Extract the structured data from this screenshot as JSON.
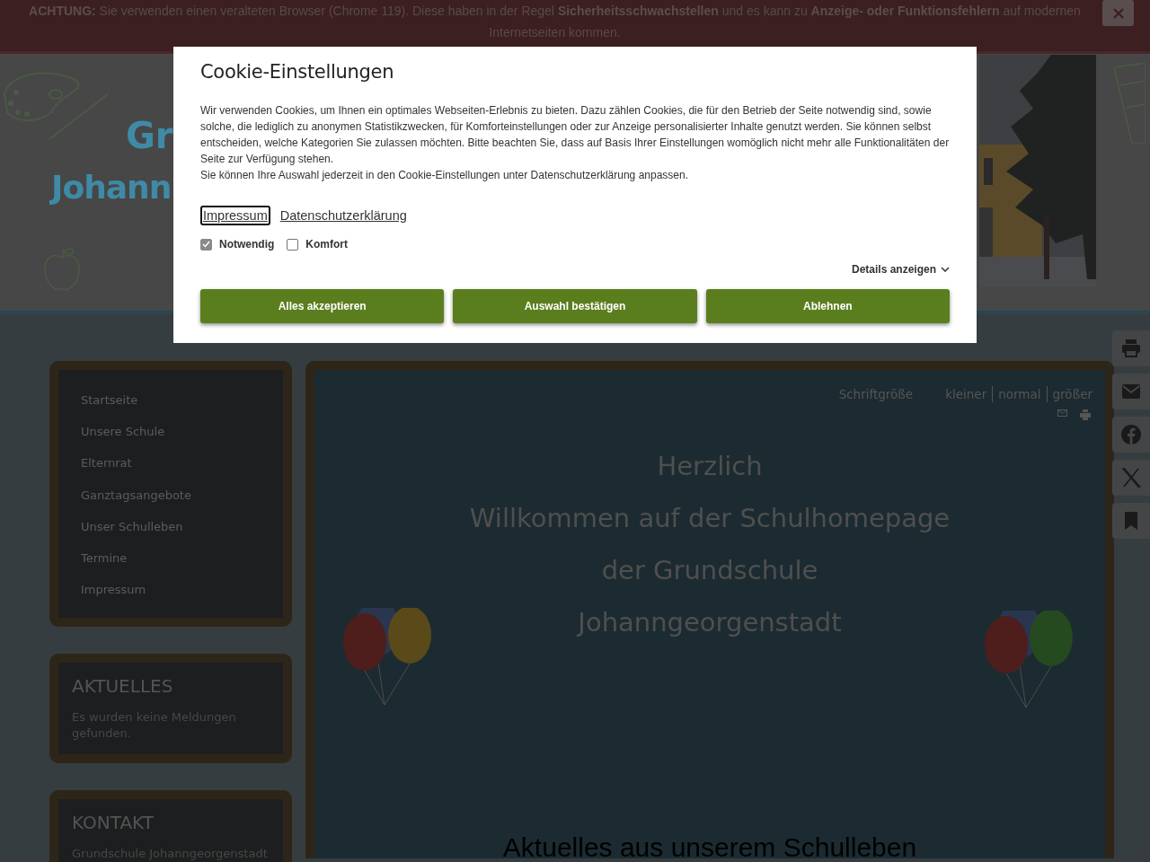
{
  "browser_warning": {
    "text": "**ACHTUNG:** Sie verwenden einen veralteten Browser (Chrome 119). Diese haben in der Regel **Sicherheitsschwachstellen** und es kann zu **Anzeige- oder Funktionsfehlern** auf modernen Internetseiten kommen."
  },
  "header": {
    "logo_lines": [
      "Gr",
      "Johann"
    ]
  },
  "navigation": [
    {
      "label": "Startseite"
    },
    {
      "label": "Unsere Schule"
    },
    {
      "label": "Elternrat"
    },
    {
      "label": "Ganztagsangebote"
    },
    {
      "label": "Unser Schulleben"
    },
    {
      "label": "Termine"
    },
    {
      "label": "Impressum"
    }
  ],
  "aktuelles": {
    "title": "AKTUELLES",
    "text": "Es wurden keine Meldungen gefunden."
  },
  "kontakt": {
    "title": "KONTAKT",
    "text": "Grundschule Johanngeorgenstadt"
  },
  "font_size": {
    "label": "Schriftgröße",
    "options": [
      "kleiner",
      "normal",
      "größer"
    ]
  },
  "welcome_lines": [
    "Herzlich",
    "Willkommen auf der Schulhomepage",
    "der Grundschule",
    "Johanngeorgenstadt"
  ],
  "section_heading": "Aktuelles aus unserem Schulleben",
  "cookie_dialog": {
    "title": "Cookie-Einstellungen",
    "paragraphs": [
      "Wir verwenden Cookies, um Ihnen ein optimales Webseiten-Erlebnis zu bieten. Dazu zählen Cookies, die für den Betrieb der Seite notwendig sind, sowie solche, die lediglich zu anonymen Statistikzwecken, für Komforteinstellungen oder zur Anzeige personalisierter Inhalte genutzt werden. Sie können selbst entscheiden, welche Kategorien Sie zulassen möchten. Bitte beachten Sie, dass auf Basis Ihrer Einstellungen womöglich nicht mehr alle Funktionalitäten der Seite zur Verfügung stehen.",
      "Sie können Ihre Auswahl jederzeit in den Cookie-Einstellungen unter Datenschutzerklärung anpassen."
    ],
    "links": [
      {
        "label": "Impressum",
        "focused": true
      },
      {
        "label": "Datenschutzerklärung",
        "focused": false
      }
    ],
    "categories": [
      {
        "label": "Notwendig",
        "checked": true,
        "disabled": true
      },
      {
        "label": "Komfort",
        "checked": false,
        "disabled": false
      }
    ],
    "details": "Details anzeigen",
    "buttons": [
      "Alles akzeptieren",
      "Auswahl bestätigen",
      "Ablehnen"
    ]
  }
}
